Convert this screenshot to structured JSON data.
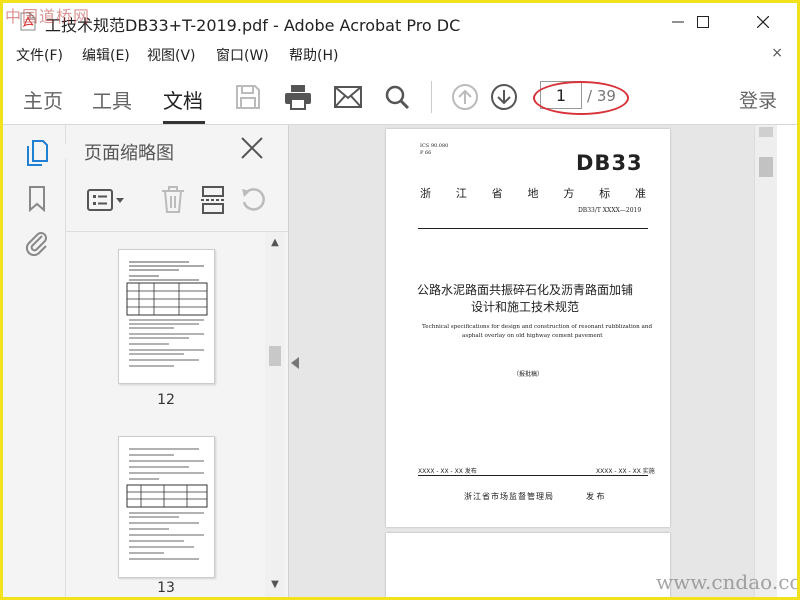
{
  "window": {
    "title": "工技术规范DB33+T-2019.pdf - Adobe Acrobat Pro DC"
  },
  "menu": [
    "文件(F)",
    "编辑(E)",
    "视图(V)",
    "窗口(W)",
    "帮助(H)"
  ],
  "menu_close": "×",
  "tabs": [
    {
      "label": "主页"
    },
    {
      "label": "工具"
    },
    {
      "label": "文档"
    }
  ],
  "nav": {
    "current_page": "1",
    "total": "/ 39"
  },
  "toolbar": {
    "login": "登录"
  },
  "panel": {
    "title": "页面缩略图",
    "thumbnails": [
      {
        "label": "12"
      },
      {
        "label": "13"
      }
    ]
  },
  "document": {
    "ics": "ICS 90.080",
    "p_code": "P 66",
    "code": "DB33",
    "province": [
      "浙",
      "江",
      "省",
      "地",
      "方",
      "标",
      "准"
    ],
    "std_no": "DB33/T XXXX—2019",
    "title_line1": "公路水泥路面共振碎石化及沥青路面加铺",
    "title_line2": "设计和施工技术规范",
    "en_line1": "Technical specifications for design and construction of resonant rubblization and",
    "en_line2": "asphalt overlay on old highway cement pavement",
    "draft": "（报批稿）",
    "publish_date": "XXXX - XX - XX 发布",
    "implement_date": "XXXX - XX - XX 实施",
    "issuer": "浙江省市场监督管理局",
    "issuer_action": "发 布"
  },
  "watermarks": {
    "top_left": "中国道桥网",
    "bottom_right": "www.cndao.com"
  },
  "colors": {
    "frame": "#f2e21c",
    "annotation": "#d8323a"
  }
}
